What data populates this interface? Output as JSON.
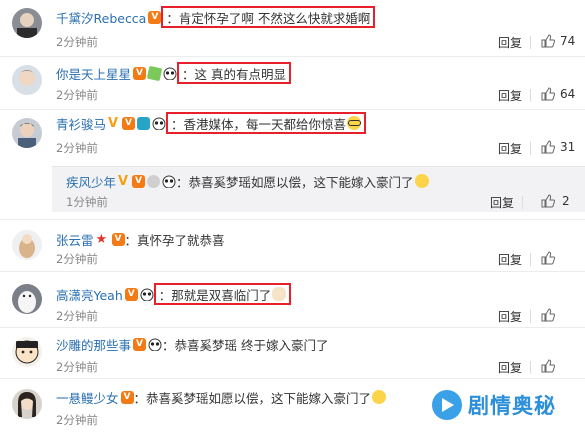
{
  "labels": {
    "reply": "回复"
  },
  "comments": [
    {
      "user": "千黛汐Rebecca",
      "text": "：肯定怀孕了啊 不然这么快就求婚啊",
      "time": "2分钟前",
      "likes": "74",
      "highlighted": true
    },
    {
      "user": "你是天上星星",
      "text": "：这 真的有点明显",
      "time": "2分钟前",
      "likes": "64",
      "highlighted": true
    },
    {
      "user": "青衫骏马",
      "text": "：香港媒体，每一天都给你惊喜",
      "time": "2分钟前",
      "likes": "31",
      "highlighted": true,
      "reply": {
        "user": "疾风少年",
        "text": "：恭喜奚梦瑶如愿以偿，这下能嫁入豪门了",
        "time": "1分钟前",
        "likes": "2"
      }
    },
    {
      "user": "张云雷",
      "text": "：真怀孕了就恭喜",
      "time": "2分钟前",
      "likes": "",
      "highlighted": false
    },
    {
      "user": "高潇亮Yeah",
      "text": "：那就是双喜临门了",
      "time": "2分钟前",
      "likes": "",
      "highlighted": true
    },
    {
      "user": "沙雕的那些事",
      "text": "：恭喜奚梦瑶 终于嫁入豪门了",
      "time": "2分钟前",
      "likes": "",
      "highlighted": false
    },
    {
      "user": "一悬鳗少女",
      "text": "：恭喜奚梦瑶如愿以偿，这下能嫁入豪门了",
      "time": "2分钟前",
      "likes": "",
      "highlighted": false
    }
  ],
  "watermark": {
    "text": "剧情奥秘"
  },
  "colors": {
    "username": "#2a6fb0",
    "highlight_border": "#e8202b",
    "reply_panel": "#f2f2f5"
  }
}
